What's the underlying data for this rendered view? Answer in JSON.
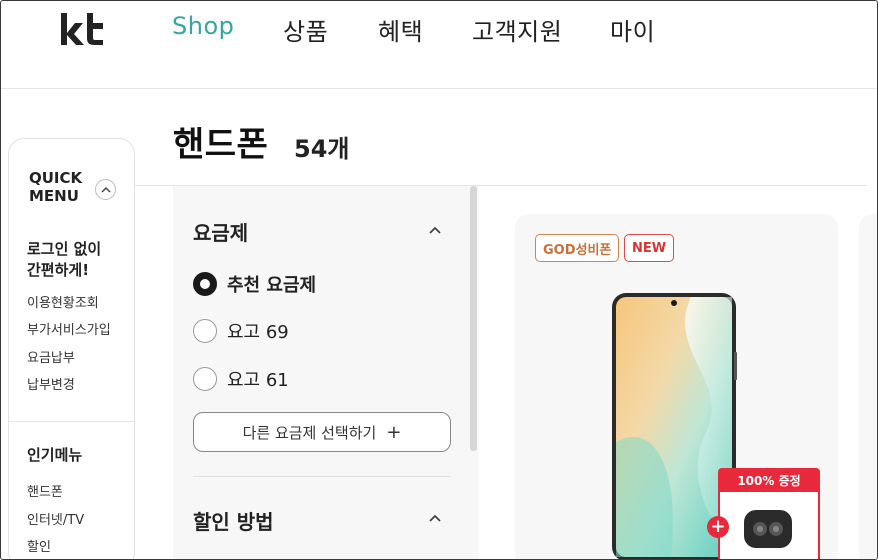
{
  "header": {
    "logo_text": "kt",
    "nav": [
      {
        "label": "Shop",
        "active": true
      },
      {
        "label": "상품",
        "active": false
      },
      {
        "label": "혜택",
        "active": false
      },
      {
        "label": "고객지원",
        "active": false
      },
      {
        "label": "마이",
        "active": false
      }
    ]
  },
  "page": {
    "title": "핸드폰",
    "count": "54개"
  },
  "quick_menu": {
    "title_line1": "QUICK",
    "title_line2": "MENU",
    "login_line1": "로그인 없이",
    "login_line2": "간편하게!",
    "links": [
      "이용현황조회",
      "부가서비스가입",
      "요금납부",
      "납부변경"
    ],
    "popular_title": "인기메뉴",
    "popular_links": [
      "핸드폰",
      "인터넷/TV",
      "할인"
    ]
  },
  "filter": {
    "plan_heading": "요금제",
    "options": [
      {
        "label": "추천 요금제",
        "checked": true
      },
      {
        "label": "요고 69",
        "checked": false
      },
      {
        "label": "요고 61",
        "checked": false
      }
    ],
    "select_other_label": "다른 요금제 선택하기",
    "select_other_icon": "+",
    "discount_heading": "할인 방법"
  },
  "product": {
    "badges": [
      "GOD성비폰",
      "NEW"
    ],
    "gift_label": "100% 증정",
    "gift_plus": "+"
  },
  "colors": {
    "accent": "#35a6a0",
    "logo": "#e2202c",
    "badge_god": "#c8703a",
    "badge_new": "#d93333",
    "gift": "#e8293b"
  }
}
